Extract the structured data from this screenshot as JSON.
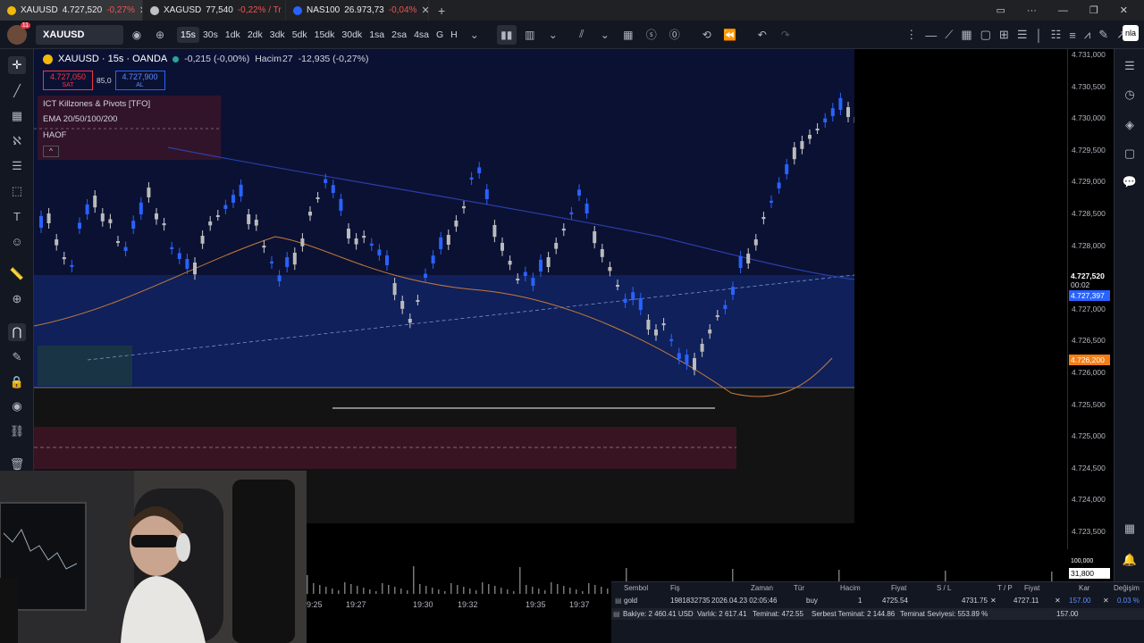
{
  "browser": {
    "tabs": [
      {
        "symbol": "XAUUSD",
        "price": "4.727,520",
        "change": "-0,27%",
        "active": true
      },
      {
        "symbol": "XAGUSD",
        "price": "77,540",
        "change": "-0,22% / Tr",
        "active": false
      },
      {
        "symbol": "NAS100",
        "price": "26.973,73",
        "change": "-0,04%",
        "active": false
      }
    ],
    "new_tab": "+",
    "close": "✕"
  },
  "toolbar": {
    "avatar_badge": "11",
    "symbol": "XAUUSD",
    "intervals": [
      "15s",
      "30s",
      "1dk",
      "2dk",
      "3dk",
      "5dk",
      "15dk",
      "30dk",
      "1sa",
      "2sa",
      "4sa",
      "G",
      "H"
    ],
    "selected_interval": "15s",
    "extra_label": "nla"
  },
  "legend": {
    "title": "XAUUSD · 15s · OANDA",
    "change": "-0,215 (-0,00%)",
    "volume_label": "Hacim",
    "volume_value": "27",
    "volume_change": "-12,935 (-0,27%)",
    "sell_price": "4.727,050",
    "sell_label": "SAT",
    "spread": "85,0",
    "buy_price": "4.727,900",
    "buy_label": "AL",
    "indicators": [
      "ICT Killzones & Pivots [TFO]",
      "EMA 20/50/100/200",
      "HAOF"
    ],
    "collapse": "^"
  },
  "price_scale": {
    "ticks": [
      "4.731,000",
      "4.730,500",
      "4.730,000",
      "4.729,500",
      "4.729,000",
      "4.728,500",
      "4.728,000",
      "4.727,500",
      "4.727,000",
      "4.726,500",
      "4.726,000",
      "4.725,500",
      "4.725,000",
      "4.724,500",
      "4.724,000",
      "4.723,500"
    ],
    "last_price": "4.727,520",
    "countdown": "00:02",
    "blue_tag": "4.727,397",
    "orange_tag": "4.726,200",
    "volume_tag": "31,800",
    "volume_tag_top": "100,000",
    "colors": {
      "blue_tag": "#2962ff",
      "orange_tag": "#f57f17"
    }
  },
  "time_axis": {
    "labels": [
      "9:25",
      "19:27",
      "19:30",
      "19:32",
      "19:35",
      "19:37"
    ]
  },
  "positions": {
    "headers": [
      "Sembol",
      "Fiş",
      "Zaman",
      "Tür",
      "Hacim",
      "Fiyat",
      "S / L",
      "T / P",
      "Fiyat",
      "Kar",
      "Değişim"
    ],
    "row": {
      "symbol": "gold",
      "ticket": "1981832735",
      "time": "2026.04.23 02:05:46",
      "type": "buy",
      "volume": "1",
      "open_price": "4725.54",
      "sl": "4731.75",
      "tp": "4727.11",
      "price": "157.00",
      "profit": "0.03 %",
      "change": ""
    },
    "summary": {
      "balance": "Bakiye: 2 460.41 USD",
      "equity": "Varlık: 2 617.41",
      "margin": "Teminat: 472.55",
      "free_margin": "Serbest Teminat: 2 144.86",
      "margin_level": "Teminat Seviyesi: 553.89 %",
      "total": "157.00"
    }
  }
}
